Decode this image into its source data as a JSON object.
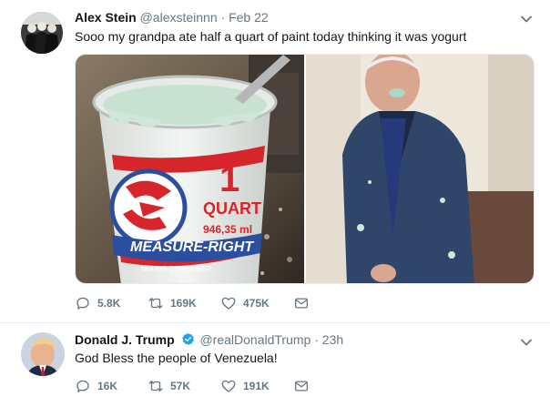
{
  "tweets": [
    {
      "name": "Alex Stein",
      "handle": "@alexsteinnn",
      "separator": "·",
      "time": "Feb 22",
      "text": "Sooo my grandpa ate half a quart of paint today thinking it was yogurt",
      "media_left_label": {
        "number": "1",
        "unit": "QUART",
        "volume": "946,35 ml",
        "brand": "MEASURE-RIGHT",
        "tagline": "MIXING CONTAINER"
      },
      "replies": "5.8K",
      "retweets": "169K",
      "likes": "475K"
    },
    {
      "name": "Donald J. Trump",
      "handle": "@realDonaldTrump",
      "separator": "·",
      "time": "23h",
      "text": "God Bless the people of Venezuela!",
      "replies": "16K",
      "retweets": "57K",
      "likes": "191K"
    }
  ],
  "icons": {
    "reply": "speech-bubble-icon",
    "retweet": "retweet-arrows-icon",
    "like": "heart-outline-icon",
    "dm": "envelope-icon",
    "caret": "chevron-down-icon",
    "verified": "verified-badge-icon"
  },
  "colors": {
    "text": "#14171a",
    "secondary": "#657786",
    "border": "#e6ecf0",
    "verified": "#1da1f2",
    "paint": "#cfe6d8",
    "label_red": "#d6262b",
    "label_blue": "#2b4f9e"
  }
}
